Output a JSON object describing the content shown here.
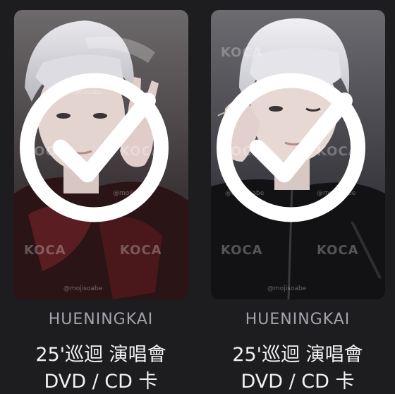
{
  "cards": [
    {
      "name": "HUENINGKAI",
      "title_line1": "25'巡迴 演唱會",
      "title_line2": "DVD / CD 卡",
      "watermark": "KOCA",
      "handle": "@mojisoabe",
      "selected": true
    },
    {
      "name": "HUENINGKAI",
      "title_line1": "25'巡迴 演唱會",
      "title_line2": "DVD / CD 卡",
      "watermark": "KOCA",
      "handle": "@mojisoabe",
      "selected": true
    }
  ],
  "colors": {
    "background": "#1d1d20",
    "name_text": "#a4a4ac",
    "title_text": "#f2f2f2"
  }
}
